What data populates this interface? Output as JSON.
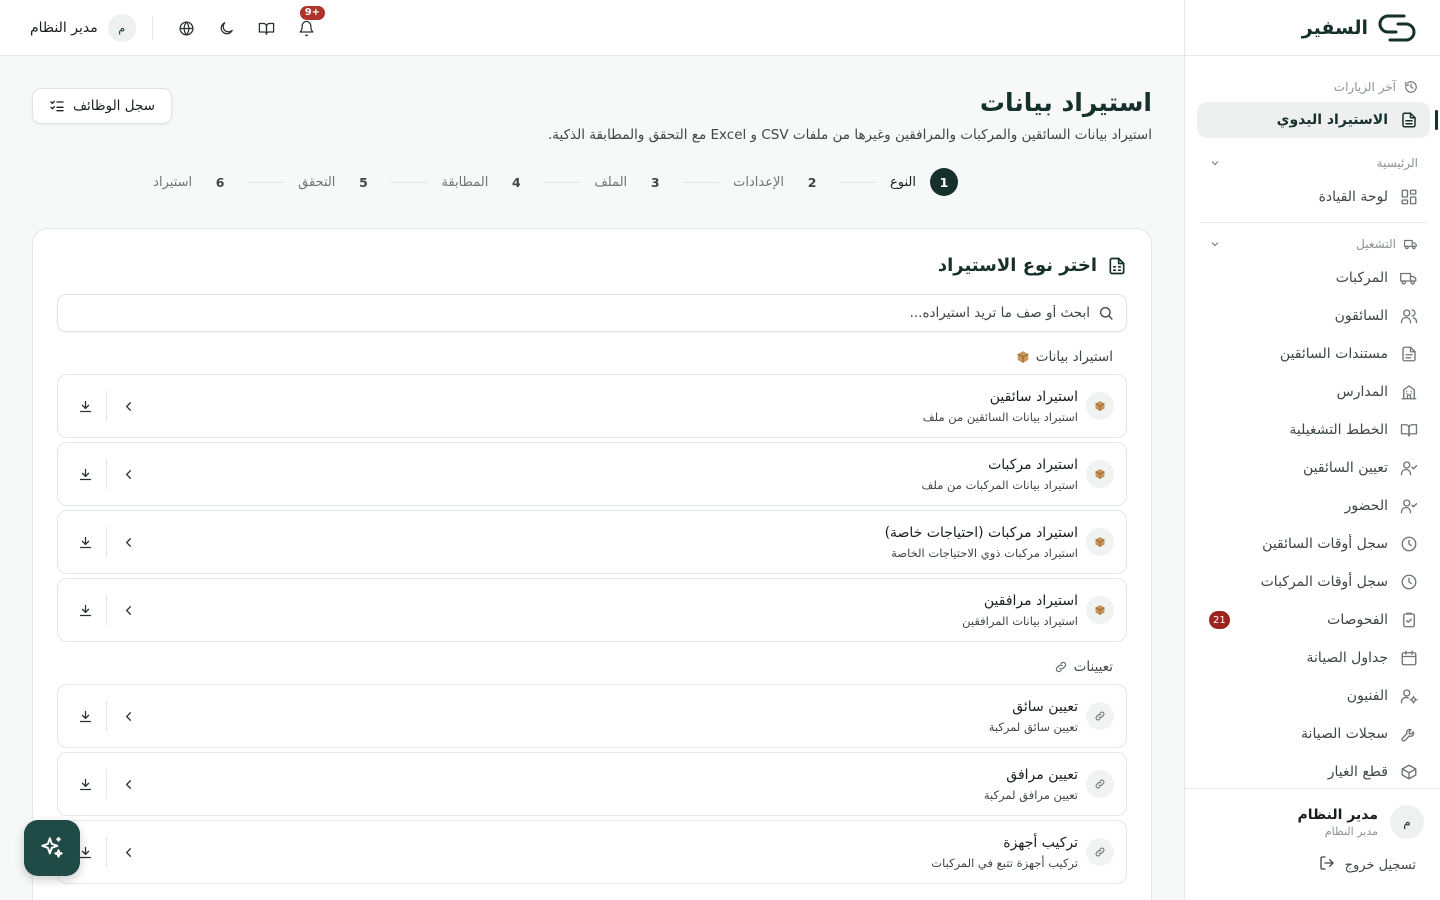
{
  "brand": {
    "name": "السفير"
  },
  "topbar": {
    "user_name": "مدير النظام",
    "user_initial": "م",
    "notif_count": "9+",
    "icons": [
      "bell-icon",
      "book-icon",
      "moon-icon",
      "globe-icon"
    ]
  },
  "sidebar": {
    "recent_label": "آخر الزيارات",
    "active_item": "الاستيراد اليدوي",
    "section_home": "الرئيسية",
    "dashboard": "لوحة القيادة",
    "section_ops": "التشغيل",
    "items": [
      {
        "label": "المركبات",
        "icon": "truck-icon"
      },
      {
        "label": "السائقون",
        "icon": "users-icon"
      },
      {
        "label": "مستندات السائقين",
        "icon": "document-icon"
      },
      {
        "label": "المدارس",
        "icon": "school-icon"
      },
      {
        "label": "الخطط التشغيلية",
        "icon": "book-open-icon"
      },
      {
        "label": "تعيين السائقين",
        "icon": "user-check-icon"
      },
      {
        "label": "الحضور",
        "icon": "user-check-icon"
      },
      {
        "label": "سجل أوقات السائقين",
        "icon": "clock-icon"
      },
      {
        "label": "سجل أوقات المركبات",
        "icon": "clock-icon"
      },
      {
        "label": "الفحوصات",
        "icon": "clipboard-check-icon",
        "badge": "21"
      },
      {
        "label": "جداول الصيانة",
        "icon": "calendar-icon"
      },
      {
        "label": "الفنيون",
        "icon": "user-cog-icon"
      },
      {
        "label": "سجلات الصيانة",
        "icon": "wrench-icon"
      },
      {
        "label": "قطع الغيار",
        "icon": "package-icon"
      }
    ],
    "user": {
      "name": "مدير النظام",
      "role": "مدير النظام",
      "initial": "م"
    },
    "logout": "تسجيل خروج"
  },
  "page": {
    "title": "استيراد بيانات",
    "subtitle": "استيراد بيانات السائقين والمركبات والمرافقين وغيرها من ملفات CSV و Excel مع التحقق والمطابقة الذكية.",
    "history_button": "سجل الوظائف"
  },
  "stepper": [
    {
      "num": "1",
      "label": "النوع",
      "active": true
    },
    {
      "num": "2",
      "label": "الإعدادات"
    },
    {
      "num": "3",
      "label": "الملف"
    },
    {
      "num": "4",
      "label": "المطابقة"
    },
    {
      "num": "5",
      "label": "التحقق"
    },
    {
      "num": "6",
      "label": "استيراد"
    }
  ],
  "card": {
    "title": "اختر نوع الاستيراد",
    "search_placeholder": "ابحث أو صف ما تريد استيراده...",
    "groups": [
      {
        "title": "استيراد بيانات",
        "emoji": "📦",
        "items": [
          {
            "title": "استيراد سائقين",
            "desc": "استيراد بيانات السائقين من ملف"
          },
          {
            "title": "استيراد مركبات",
            "desc": "استيراد بيانات المركبات من ملف"
          },
          {
            "title": "استيراد مركبات (احتياجات خاصة)",
            "desc": "استيراد مركبات ذوي الاحتياجات الخاصة"
          },
          {
            "title": "استيراد مرافقين",
            "desc": "استيراد بيانات المرافقين"
          }
        ]
      },
      {
        "title": "تعيينات",
        "emoji": "🔗",
        "items": [
          {
            "title": "تعيين سائق",
            "desc": "تعيين سائق لمركبة"
          },
          {
            "title": "تعيين مرافق",
            "desc": "تعيين مرافق لمركبة"
          },
          {
            "title": "تركيب أجهزة",
            "desc": "تركيب أجهزة تتبع في المركبات"
          }
        ]
      }
    ]
  },
  "colors": {
    "brand": "#16302b",
    "badge": "#9b2420",
    "fab": "#1f4a45"
  }
}
